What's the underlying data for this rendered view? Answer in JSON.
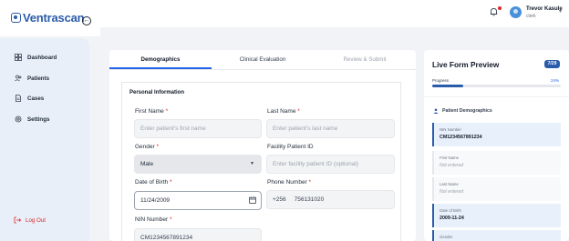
{
  "brand": {
    "logo_text": "Ventrascan"
  },
  "sidebar": {
    "items": [
      {
        "label": "Dashboard",
        "icon": "grid-icon"
      },
      {
        "label": "Patients",
        "icon": "users-icon"
      },
      {
        "label": "Cases",
        "icon": "file-icon"
      },
      {
        "label": "Settings",
        "icon": "gear-icon"
      }
    ],
    "logout_label": "Log Out"
  },
  "header": {
    "user_name": "Trevor Kasule",
    "user_role": "clerk",
    "notification_dot": true
  },
  "tabs": [
    {
      "label": "Demographics",
      "state": "active"
    },
    {
      "label": "Clinical Evaluation",
      "state": "normal"
    },
    {
      "label": "Review & Submit",
      "state": "disabled"
    }
  ],
  "form": {
    "section_title": "Personal Information",
    "first_name": {
      "label": "First Name",
      "required": "*",
      "placeholder": "Enter patient's first name"
    },
    "last_name": {
      "label": "Last Name",
      "required": "*",
      "placeholder": "Enter patient's last name"
    },
    "gender": {
      "label": "Gender",
      "required": "*",
      "value": "Male"
    },
    "facility_id": {
      "label": "Facility Patient ID",
      "placeholder": "Enter facility patient ID (optional)"
    },
    "dob": {
      "label": "Date of Birth",
      "required": "*",
      "value": "11/24/2009"
    },
    "phone": {
      "label": "Phone Number",
      "required": "*",
      "prefix": "+256",
      "value": "756131020"
    },
    "nin": {
      "label": "NIN Number",
      "required": "*",
      "value": "CM1234567891234"
    }
  },
  "preview": {
    "title": "Live Form Preview",
    "badge": "7/29",
    "progress_label": "Progress",
    "progress_pct": "24%",
    "progress_value": 0.24,
    "section": "Patient Demographics",
    "items": [
      {
        "label": "NIN Number",
        "value": "CM1234567891234",
        "filled": true
      },
      {
        "label": "First Name",
        "value": "Not entered",
        "filled": false
      },
      {
        "label": "Last Name",
        "value": "Not entered",
        "filled": false
      },
      {
        "label": "Date of Birth",
        "value": "2009-11-24",
        "filled": true
      },
      {
        "label": "Gender",
        "value": "",
        "filled": true
      }
    ]
  },
  "colors": {
    "brand": "#2b5cab",
    "accent": "#2563eb",
    "danger": "#dc2626"
  }
}
